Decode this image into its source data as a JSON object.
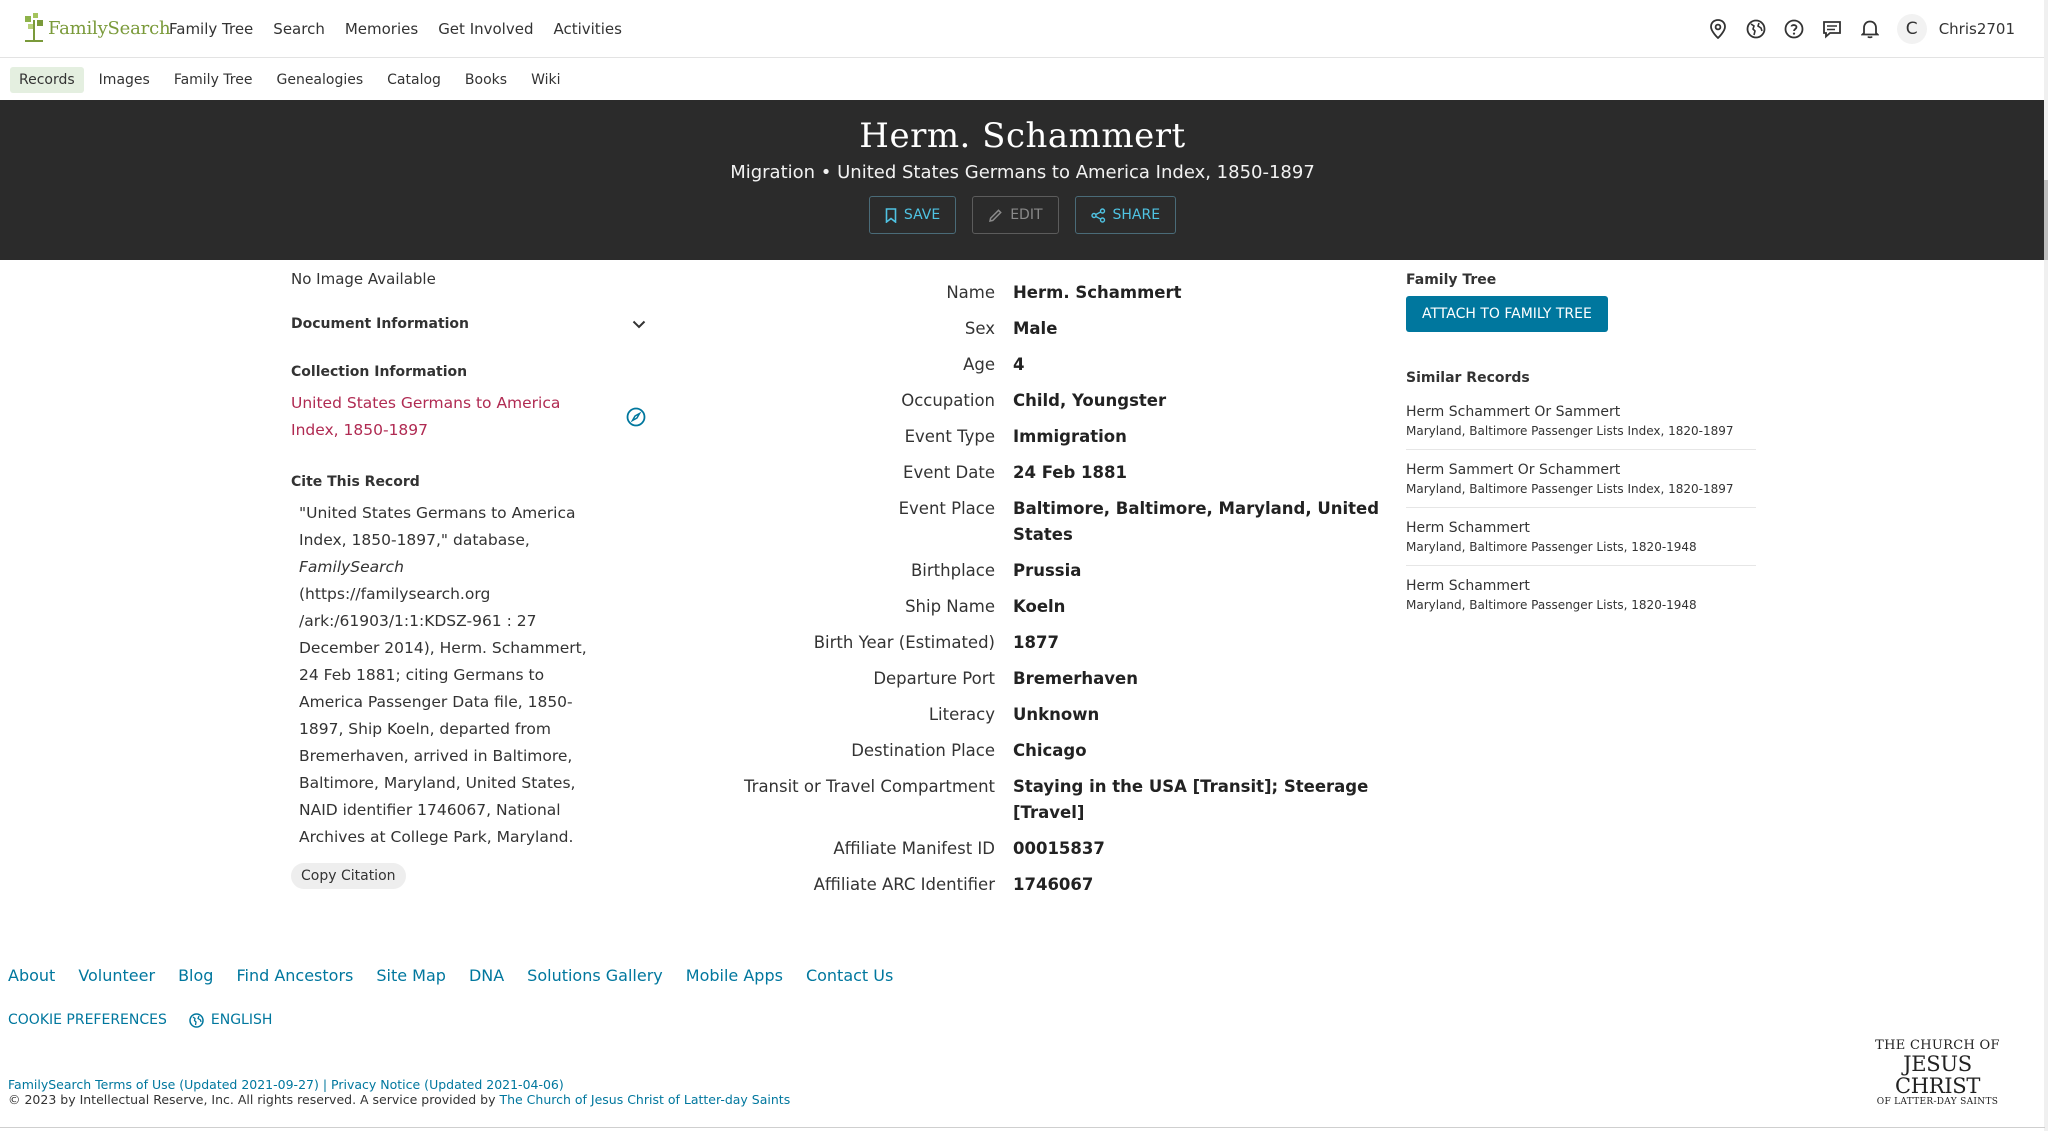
{
  "header": {
    "brand": "FamilySearch",
    "nav": [
      "Family Tree",
      "Search",
      "Memories",
      "Get Involved",
      "Activities"
    ],
    "avatar_initial": "C",
    "username": "Chris2701",
    "icons": [
      "location-pin-icon",
      "globe-icon",
      "help-icon",
      "chat-icon",
      "bell-icon"
    ]
  },
  "subnav": {
    "items": [
      "Records",
      "Images",
      "Family Tree",
      "Genealogies",
      "Catalog",
      "Books",
      "Wiki"
    ],
    "active": "Records"
  },
  "hero": {
    "title": "Herm. Schammert",
    "subtitle": "Migration • United States Germans to America Index, 1850-1897",
    "save": "SAVE",
    "edit": "EDIT",
    "share": "SHARE"
  },
  "left": {
    "no_image": "No Image Available",
    "doc_info": "Document Information",
    "coll_info": "Collection Information",
    "coll_link": "United States Germans to America Index, 1850-1897",
    "cite_heading": "Cite This Record",
    "cite_text_1": "\"United States Germans to America Index, 1850-1897,\" database, ",
    "cite_text_italic": "FamilySearch",
    "cite_text_2": " (https://familysearch.org /ark:/61903/1:1:KDSZ-961 : 27 December 2014), Herm. Schammert, 24 Feb 1881; citing Germans to America Passenger Data file, 1850-1897, Ship Koeln, departed from Bremerhaven, arrived in Baltimore, Baltimore, Maryland, United States, NAID identifier 1746067, National Archives at College Park, Maryland.",
    "copy_citation": "Copy Citation"
  },
  "facts": [
    {
      "label": "Name",
      "value": "Herm. Schammert"
    },
    {
      "label": "Sex",
      "value": "Male"
    },
    {
      "label": "Age",
      "value": "4"
    },
    {
      "label": "Occupation",
      "value": "Child, Youngster"
    },
    {
      "label": "Event Type",
      "value": "Immigration"
    },
    {
      "label": "Event Date",
      "value": "24 Feb 1881"
    },
    {
      "label": "Event Place",
      "value": "Baltimore, Baltimore, Maryland, United States"
    },
    {
      "label": "Birthplace",
      "value": "Prussia"
    },
    {
      "label": "Ship Name",
      "value": "Koeln"
    },
    {
      "label": "Birth Year (Estimated)",
      "value": "1877"
    },
    {
      "label": "Departure Port",
      "value": "Bremerhaven"
    },
    {
      "label": "Literacy",
      "value": "Unknown"
    },
    {
      "label": "Destination Place",
      "value": "Chicago"
    },
    {
      "label": "Transit or Travel Compartment",
      "value": "Staying in the USA [Transit]; Steerage [Travel]"
    },
    {
      "label": "Affiliate Manifest ID",
      "value": "00015837"
    },
    {
      "label": "Affiliate ARC Identifier",
      "value": "1746067"
    }
  ],
  "right": {
    "family_tree_heading": "Family Tree",
    "attach_button": "ATTACH TO FAMILY TREE",
    "similar_heading": "Similar Records",
    "similar": [
      {
        "name": "Herm Schammert Or Sammert",
        "collection": "Maryland, Baltimore Passenger Lists Index, 1820-1897"
      },
      {
        "name": "Herm Sammert Or Schammert",
        "collection": "Maryland, Baltimore Passenger Lists Index, 1820-1897"
      },
      {
        "name": "Herm Schammert",
        "collection": "Maryland, Baltimore Passenger Lists, 1820-1948"
      },
      {
        "name": "Herm Schammert",
        "collection": "Maryland, Baltimore Passenger Lists, 1820-1948"
      }
    ]
  },
  "footer": {
    "links": [
      "About",
      "Volunteer",
      "Blog",
      "Find Ancestors",
      "Site Map",
      "DNA",
      "Solutions Gallery",
      "Mobile Apps",
      "Contact Us"
    ],
    "cookie": "COOKIE PREFERENCES",
    "language": "ENGLISH",
    "terms": "FamilySearch Terms of Use (Updated 2021-09-27)",
    "divider": "|",
    "privacy": "Privacy Notice (Updated 2021-04-06)",
    "copyright": "© 2023 by Intellectual Reserve, Inc. All rights reserved. A service provided by ",
    "church_link": "The Church of Jesus Christ of Latter-day Saints",
    "logo_line1": "THE CHURCH OF",
    "logo_line2": "JESUS CHRIST",
    "logo_line3": "OF LATTER-DAY SAINTS"
  }
}
